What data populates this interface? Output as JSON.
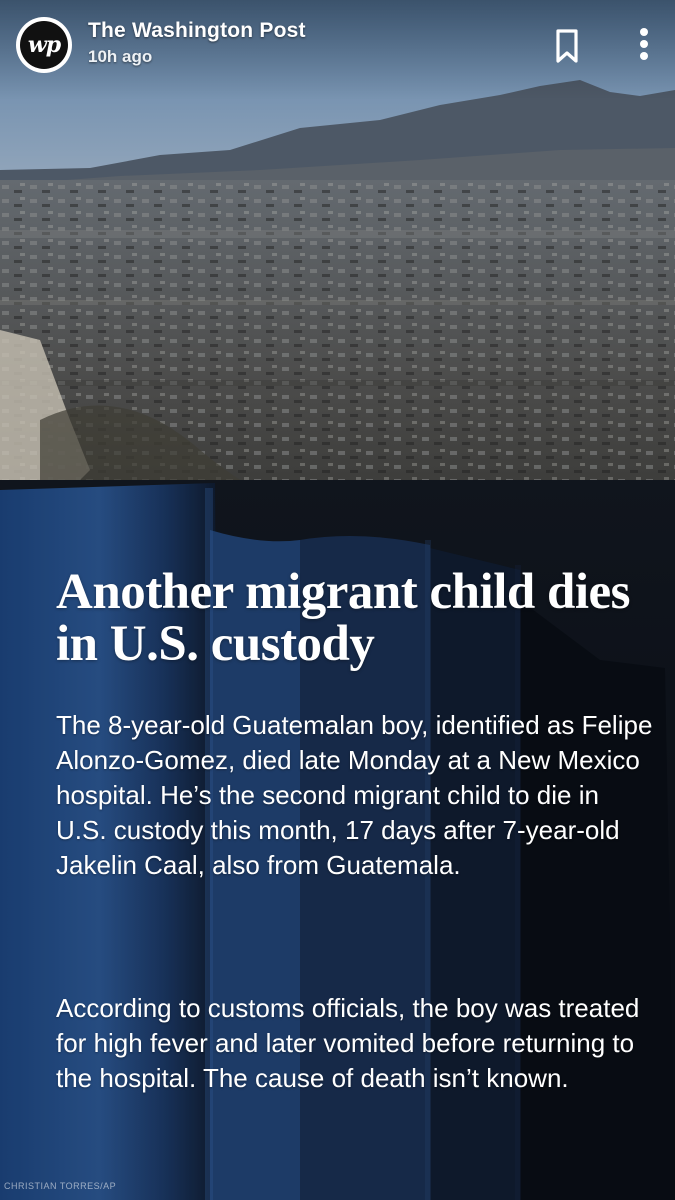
{
  "header": {
    "publisher": "The Washington Post",
    "avatar_text": "wp",
    "time_ago": "10h ago",
    "icons": {
      "avatar": "wp-logo",
      "bookmark": "bookmark-icon",
      "more": "more-vertical-icon"
    }
  },
  "story": {
    "headline": "Another migrant child dies in U.S. custody",
    "paragraphs": [
      "The 8-year-old Guatemalan boy, identified as Felipe Alonzo-Gomez, died late Monday at a New Mexico hospital. He’s the second migrant child to die in U.S. custody this month, 17 days after 7-year-old Jakelin Caal, also from Guatemala.",
      "According to customs officials, the boy was treated for high fever and later vomited before returning to the hospital. The cause of death isn’t known."
    ],
    "photo_credit": "CHRISTIAN TORRES/AP"
  },
  "colors": {
    "sky": "#5b7fa6",
    "mountains": "#4d5866",
    "fence_blue": "#2c5a9c",
    "text": "#ffffff"
  }
}
